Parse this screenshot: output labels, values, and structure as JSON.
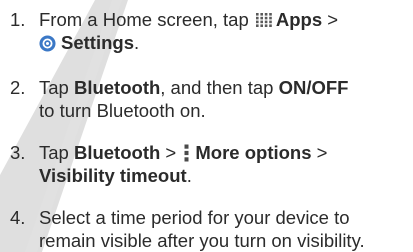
{
  "steps": [
    {
      "number": "1.",
      "line1": {
        "t1": "From a Home screen, tap ",
        "b1": "Apps",
        "t2": " >"
      },
      "line2": {
        "b1": "Settings",
        "t1": "."
      }
    },
    {
      "number": "2.",
      "line1": {
        "t1": "Tap ",
        "b1": "Bluetooth",
        "t2": ", and then tap ",
        "b2": "ON/OFF"
      },
      "line2": {
        "t1": "to turn Bluetooth on."
      }
    },
    {
      "number": "3.",
      "line1": {
        "t1": "Tap ",
        "b1": "Bluetooth",
        "t2": " > ",
        "b2": "More options",
        "t3": " >"
      },
      "line2": {
        "b1": "Visibility timeout",
        "t1": "."
      }
    },
    {
      "number": "4.",
      "line1": {
        "t1": "Select a time period for your device to"
      },
      "line2": {
        "t1": "remain visible after you turn on visibility."
      }
    }
  ],
  "icons": {
    "apps": "apps-grid-icon",
    "settings": "settings-gear-icon",
    "more": "more-options-icon"
  },
  "colors": {
    "text": "#2b2b2b",
    "settings_icon": "#3b78c6",
    "watermark": "#c4c4c4"
  }
}
